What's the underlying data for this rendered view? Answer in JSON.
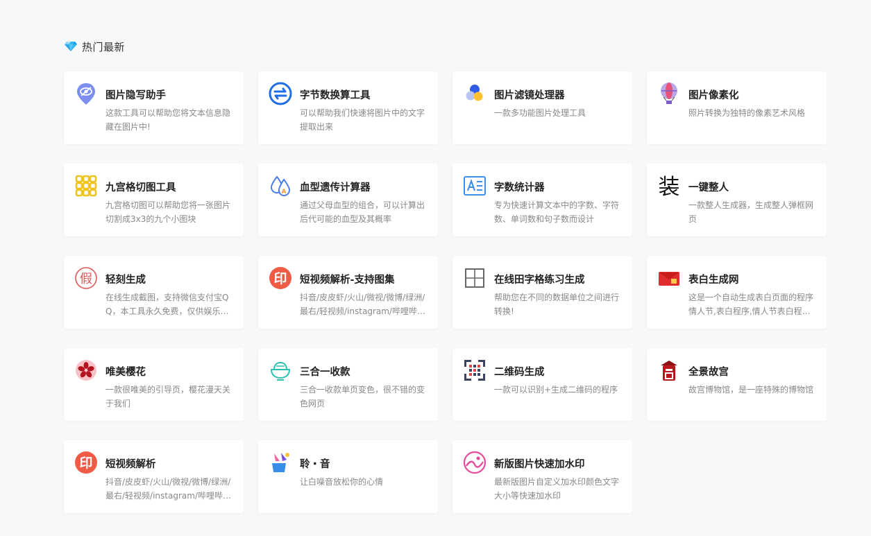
{
  "section": {
    "title": "热门最新"
  },
  "cards": [
    {
      "title": "图片隐写助手",
      "desc": "这款工具可以帮助您将文本信息隐藏在图片中!",
      "icon": "eye-pin-icon"
    },
    {
      "title": "字节数换算工具",
      "desc": "可以帮助我们快速将图片中的文字提取出来",
      "icon": "exchange-arrows-icon"
    },
    {
      "title": "图片滤镜处理器",
      "desc": "一款多功能图片处理工具",
      "icon": "color-dots-icon"
    },
    {
      "title": "图片像素化",
      "desc": "照片转换为独特的像素艺术风格",
      "icon": "hot-air-balloon-icon"
    },
    {
      "title": "九宫格切图工具",
      "desc": "九宫格切图可以帮助您将一张图片切割成3x3的九个小图块",
      "icon": "nine-grid-icon"
    },
    {
      "title": "血型遗传计算器",
      "desc": "通过父母血型的组合，可以计算出后代可能的血型及其概率",
      "icon": "blood-drops-icon"
    },
    {
      "title": "字数统计器",
      "desc": "专为快速计算文本中的字数、字符数、单词数和句子数而设计",
      "icon": "text-count-icon"
    },
    {
      "title": "一键整人",
      "desc": "一款整人生成器，生成整人弹框网页",
      "icon": "zhuang-glyph-icon",
      "glyph": "装"
    },
    {
      "title": "轻刻生成",
      "desc": "在线生成截图，支持微信支付宝QQ，本工具永久免费，仅供娱乐，请勿用于违法用途",
      "icon": "fake-stamp-icon",
      "glyph": "假"
    },
    {
      "title": "短视频解析-支持图集",
      "desc": "抖音/皮皮虾/火山/微视/微博/绿洲/最右/轻视频/instagram/哔哩哔哩/快手等",
      "icon": "print-seal-icon",
      "glyph": "印"
    },
    {
      "title": "在线田字格练习生成",
      "desc": "帮助您在不同的数据单位之间进行转换!",
      "icon": "tian-grid-icon"
    },
    {
      "title": "表白生成网",
      "desc": "这是一个自动生成表白页面的程序情人节,表白程序,情人节表白程序大全",
      "icon": "red-envelope-icon"
    },
    {
      "title": "唯美樱花",
      "desc": "一款很唯美的引导页，樱花漫天关于我们",
      "icon": "sakura-icon"
    },
    {
      "title": "三合一收款",
      "desc": "三合一收款单页变色，很不错的变色网页",
      "icon": "bowl-icon"
    },
    {
      "title": "二维码生成",
      "desc": "一款可以识别+生成二维码的程序",
      "icon": "qr-code-icon"
    },
    {
      "title": "全景故宫",
      "desc": "故宫博物馆，是一座特殊的博物馆",
      "icon": "palace-icon"
    },
    {
      "title": "短视频解析",
      "desc": "抖音/皮皮虾/火山/微视/微博/绿洲/最右/轻视频/instagram/哔哩哔哩/快手等",
      "icon": "print-seal-icon",
      "glyph": "印"
    },
    {
      "title": "聆・音",
      "desc": "让白噪音放松你的心情",
      "icon": "music-cup-icon"
    },
    {
      "title": "新版图片快速加水印",
      "desc": "最新版图片自定义加水印颜色文字大小等快速加水印",
      "icon": "watermark-icon"
    }
  ]
}
